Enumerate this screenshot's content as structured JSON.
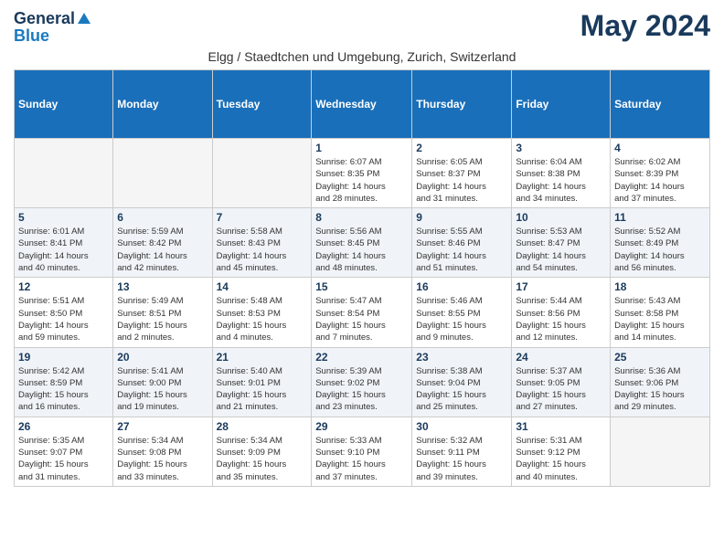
{
  "header": {
    "logo_general": "General",
    "logo_blue": "Blue",
    "month_title": "May 2024",
    "subtitle": "Elgg / Staedtchen und Umgebung, Zurich, Switzerland"
  },
  "weekdays": [
    "Sunday",
    "Monday",
    "Tuesday",
    "Wednesday",
    "Thursday",
    "Friday",
    "Saturday"
  ],
  "weeks": [
    [
      {
        "day": "",
        "info": ""
      },
      {
        "day": "",
        "info": ""
      },
      {
        "day": "",
        "info": ""
      },
      {
        "day": "1",
        "info": "Sunrise: 6:07 AM\nSunset: 8:35 PM\nDaylight: 14 hours\nand 28 minutes."
      },
      {
        "day": "2",
        "info": "Sunrise: 6:05 AM\nSunset: 8:37 PM\nDaylight: 14 hours\nand 31 minutes."
      },
      {
        "day": "3",
        "info": "Sunrise: 6:04 AM\nSunset: 8:38 PM\nDaylight: 14 hours\nand 34 minutes."
      },
      {
        "day": "4",
        "info": "Sunrise: 6:02 AM\nSunset: 8:39 PM\nDaylight: 14 hours\nand 37 minutes."
      }
    ],
    [
      {
        "day": "5",
        "info": "Sunrise: 6:01 AM\nSunset: 8:41 PM\nDaylight: 14 hours\nand 40 minutes."
      },
      {
        "day": "6",
        "info": "Sunrise: 5:59 AM\nSunset: 8:42 PM\nDaylight: 14 hours\nand 42 minutes."
      },
      {
        "day": "7",
        "info": "Sunrise: 5:58 AM\nSunset: 8:43 PM\nDaylight: 14 hours\nand 45 minutes."
      },
      {
        "day": "8",
        "info": "Sunrise: 5:56 AM\nSunset: 8:45 PM\nDaylight: 14 hours\nand 48 minutes."
      },
      {
        "day": "9",
        "info": "Sunrise: 5:55 AM\nSunset: 8:46 PM\nDaylight: 14 hours\nand 51 minutes."
      },
      {
        "day": "10",
        "info": "Sunrise: 5:53 AM\nSunset: 8:47 PM\nDaylight: 14 hours\nand 54 minutes."
      },
      {
        "day": "11",
        "info": "Sunrise: 5:52 AM\nSunset: 8:49 PM\nDaylight: 14 hours\nand 56 minutes."
      }
    ],
    [
      {
        "day": "12",
        "info": "Sunrise: 5:51 AM\nSunset: 8:50 PM\nDaylight: 14 hours\nand 59 minutes."
      },
      {
        "day": "13",
        "info": "Sunrise: 5:49 AM\nSunset: 8:51 PM\nDaylight: 15 hours\nand 2 minutes."
      },
      {
        "day": "14",
        "info": "Sunrise: 5:48 AM\nSunset: 8:53 PM\nDaylight: 15 hours\nand 4 minutes."
      },
      {
        "day": "15",
        "info": "Sunrise: 5:47 AM\nSunset: 8:54 PM\nDaylight: 15 hours\nand 7 minutes."
      },
      {
        "day": "16",
        "info": "Sunrise: 5:46 AM\nSunset: 8:55 PM\nDaylight: 15 hours\nand 9 minutes."
      },
      {
        "day": "17",
        "info": "Sunrise: 5:44 AM\nSunset: 8:56 PM\nDaylight: 15 hours\nand 12 minutes."
      },
      {
        "day": "18",
        "info": "Sunrise: 5:43 AM\nSunset: 8:58 PM\nDaylight: 15 hours\nand 14 minutes."
      }
    ],
    [
      {
        "day": "19",
        "info": "Sunrise: 5:42 AM\nSunset: 8:59 PM\nDaylight: 15 hours\nand 16 minutes."
      },
      {
        "day": "20",
        "info": "Sunrise: 5:41 AM\nSunset: 9:00 PM\nDaylight: 15 hours\nand 19 minutes."
      },
      {
        "day": "21",
        "info": "Sunrise: 5:40 AM\nSunset: 9:01 PM\nDaylight: 15 hours\nand 21 minutes."
      },
      {
        "day": "22",
        "info": "Sunrise: 5:39 AM\nSunset: 9:02 PM\nDaylight: 15 hours\nand 23 minutes."
      },
      {
        "day": "23",
        "info": "Sunrise: 5:38 AM\nSunset: 9:04 PM\nDaylight: 15 hours\nand 25 minutes."
      },
      {
        "day": "24",
        "info": "Sunrise: 5:37 AM\nSunset: 9:05 PM\nDaylight: 15 hours\nand 27 minutes."
      },
      {
        "day": "25",
        "info": "Sunrise: 5:36 AM\nSunset: 9:06 PM\nDaylight: 15 hours\nand 29 minutes."
      }
    ],
    [
      {
        "day": "26",
        "info": "Sunrise: 5:35 AM\nSunset: 9:07 PM\nDaylight: 15 hours\nand 31 minutes."
      },
      {
        "day": "27",
        "info": "Sunrise: 5:34 AM\nSunset: 9:08 PM\nDaylight: 15 hours\nand 33 minutes."
      },
      {
        "day": "28",
        "info": "Sunrise: 5:34 AM\nSunset: 9:09 PM\nDaylight: 15 hours\nand 35 minutes."
      },
      {
        "day": "29",
        "info": "Sunrise: 5:33 AM\nSunset: 9:10 PM\nDaylight: 15 hours\nand 37 minutes."
      },
      {
        "day": "30",
        "info": "Sunrise: 5:32 AM\nSunset: 9:11 PM\nDaylight: 15 hours\nand 39 minutes."
      },
      {
        "day": "31",
        "info": "Sunrise: 5:31 AM\nSunset: 9:12 PM\nDaylight: 15 hours\nand 40 minutes."
      },
      {
        "day": "",
        "info": ""
      }
    ]
  ]
}
